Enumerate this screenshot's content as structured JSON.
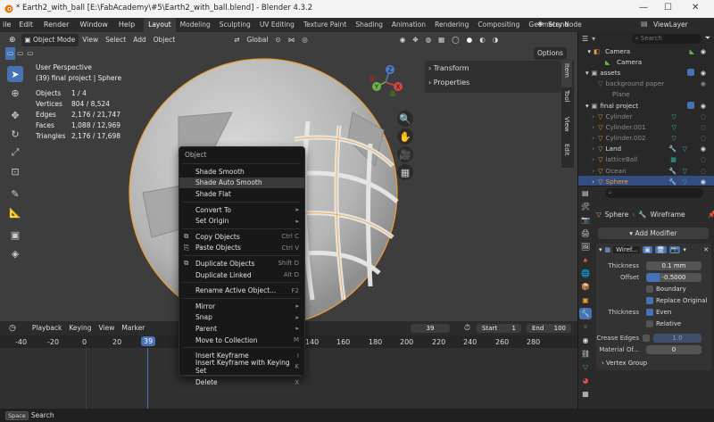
{
  "titlebar": {
    "title": "* Earth2_with_ball [E:\\FabAcademy\\#5\\Earth2_with_ball.blend] - Blender 4.3.2"
  },
  "menus": [
    "ile",
    "Edit",
    "Render",
    "Window",
    "Help"
  ],
  "workspaces": [
    "Layout",
    "Modeling",
    "Sculpting",
    "UV Editing",
    "Texture Paint",
    "Shading",
    "Animation",
    "Rendering",
    "Compositing",
    "Geometry Node"
  ],
  "scene": {
    "scene_name": "Scene",
    "view_layer": "ViewLayer"
  },
  "viewport_header": {
    "mode": "Object Mode",
    "view": "View",
    "select": "Select",
    "add": "Add",
    "object": "Object",
    "orientation": "Global",
    "options": "Options"
  },
  "overlay": {
    "view_name": "User Perspective",
    "collection": "(39) final project | Sphere",
    "stats": [
      {
        "k": "Objects",
        "v": "1 / 4"
      },
      {
        "k": "Vertices",
        "v": "804 / 8,524"
      },
      {
        "k": "Edges",
        "v": "2,176 / 21,747"
      },
      {
        "k": "Faces",
        "v": "1,088 / 12,969"
      },
      {
        "k": "Triangles",
        "v": "2,176 / 17,698"
      }
    ]
  },
  "sidepanel": {
    "transform": "Transform",
    "properties": "Properties",
    "tabs": [
      "Item",
      "Tool",
      "View",
      "Edit"
    ]
  },
  "gizmo": {
    "x": "X",
    "y": "Y",
    "z": "Z"
  },
  "context_menu": {
    "title": "Object",
    "groups": [
      [
        {
          "label": "Shade Smooth",
          "sc": ""
        },
        {
          "label": "Shade Auto Smooth",
          "sc": "",
          "hl": true
        },
        {
          "label": "Shade Flat",
          "sc": ""
        }
      ],
      [
        {
          "label": "Convert To",
          "sc": "▸"
        },
        {
          "label": "Set Origin",
          "sc": "▸"
        }
      ],
      [
        {
          "label": "Copy Objects",
          "sc": "Ctrl C",
          "ic": "⧉"
        },
        {
          "label": "Paste Objects",
          "sc": "Ctrl V",
          "ic": "⎘"
        }
      ],
      [
        {
          "label": "Duplicate Objects",
          "sc": "Shift D",
          "ic": "⧉"
        },
        {
          "label": "Duplicate Linked",
          "sc": "Alt D"
        }
      ],
      [
        {
          "label": "Rename Active Object...",
          "sc": "F2"
        }
      ],
      [
        {
          "label": "Mirror",
          "sc": "▸"
        },
        {
          "label": "Snap",
          "sc": "▸"
        },
        {
          "label": "Parent",
          "sc": "▸"
        },
        {
          "label": "Move to Collection",
          "sc": "M"
        }
      ],
      [
        {
          "label": "Insert Keyframe",
          "sc": "I"
        },
        {
          "label": "Insert Keyframe with Keying Set",
          "sc": "K"
        }
      ],
      [
        {
          "label": "Delete",
          "sc": "X"
        }
      ]
    ]
  },
  "timeline": {
    "playback": "Playback",
    "keying": "Keying",
    "view": "View",
    "marker": "Marker",
    "current_frame": "39",
    "start_label": "Start",
    "start": "1",
    "end_label": "End",
    "end": "100",
    "ruler": [
      "-40",
      "-20",
      "0",
      "20",
      "39",
      "140",
      "160",
      "180",
      "200",
      "220",
      "240",
      "260",
      "280"
    ]
  },
  "statusbar": {
    "key": "Space",
    "label": "Search"
  },
  "outliner": {
    "search_placeholder": "Search",
    "rows": [
      {
        "label": "Camera",
        "indent": 14,
        "icon": "📷",
        "color": "#e8e8e8"
      },
      {
        "label": "Camera",
        "indent": 30,
        "icon": "",
        "color": "#e8e8e8"
      },
      {
        "label": "assets",
        "indent": 6,
        "icon": "▾",
        "color": "#e8e8e8"
      },
      {
        "label": "background paper",
        "indent": 22,
        "icon": "▿",
        "color": "#8a8a8a"
      },
      {
        "label": "Plane",
        "indent": 38,
        "icon": "",
        "color": "#8a8a8a"
      },
      {
        "label": "final project",
        "indent": 6,
        "icon": "▾",
        "color": "#e8e8e8"
      },
      {
        "label": "Cylinder",
        "indent": 22,
        "icon": "▿",
        "color": "#8a8a8a"
      },
      {
        "label": "Cylinder.001",
        "indent": 22,
        "icon": "▿",
        "color": "#8a8a8a"
      },
      {
        "label": "Cylinder.002",
        "indent": 22,
        "icon": "▿",
        "color": "#8a8a8a"
      },
      {
        "label": "Land",
        "indent": 22,
        "icon": "▿",
        "color": "#e8e8e8"
      },
      {
        "label": "latticeBall",
        "indent": 22,
        "icon": "▿",
        "color": "#8a8a8a"
      },
      {
        "label": "Ocean",
        "indent": 22,
        "icon": "▿",
        "color": "#8a8a8a"
      },
      {
        "label": "Sphere",
        "indent": 22,
        "icon": "▿",
        "color": "#f0a030",
        "sel": true
      }
    ]
  },
  "properties": {
    "object": "Sphere",
    "modifier_name": "Wireframe",
    "add_modifier": "Add Modifier",
    "mod_short": "Wiref...",
    "thickness_label": "Thickness",
    "thickness": "0.1 mm",
    "offset_label": "Offset",
    "offset": "-0.5000",
    "boundary": "Boundary",
    "replace_original": "Replace Original",
    "thickness2_label": "Thickness",
    "even": "Even",
    "relative": "Relative",
    "crease_label": "Crease Edges",
    "crease": "1.0",
    "material_label": "Material Of...",
    "material": "0",
    "vertex_group": "Vertex Group"
  }
}
